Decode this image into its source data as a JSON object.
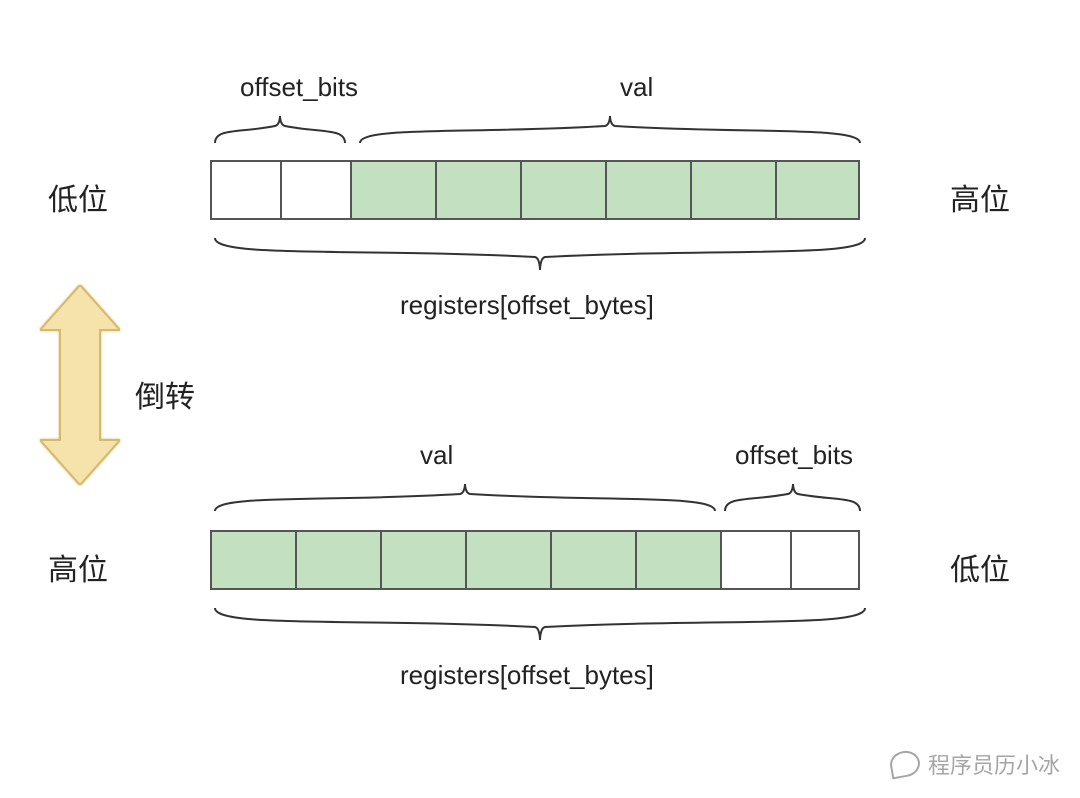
{
  "top": {
    "offset_bits": "offset_bits",
    "val": "val",
    "left_label": "低位",
    "right_label": "高位",
    "bottom": "registers[offset_bytes]"
  },
  "bottom": {
    "offset_bits": "offset_bits",
    "val": "val",
    "left_label": "高位",
    "right_label": "低位",
    "bottom": "registers[offset_bytes]"
  },
  "reverse_label": "倒转",
  "watermark": "程序员历小冰",
  "colors": {
    "filled_cell": "#c3e0c0",
    "arrow_fill": "#f6e2ab",
    "arrow_stroke": "#d6b96a"
  },
  "structure_note": "top row = 2 white cells (offset_bits) + 6 green cells (val); bottom row reversed (6 green + 2 white); arrow with '倒转' indicates reversal between the two layouts"
}
